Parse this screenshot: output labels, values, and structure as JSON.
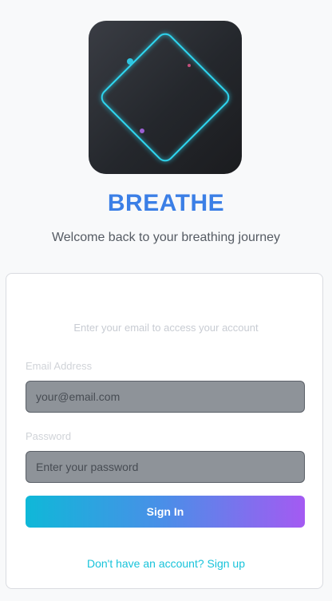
{
  "app": {
    "brand": "BREATHE",
    "tagline": "Welcome back to your breathing journey",
    "accent": "#3b7fe6",
    "logo_icon": "glowing-diamond-icon"
  },
  "login_card": {
    "subtitle": "Enter your email to access your account",
    "email_label": "Email Address",
    "email_value": "",
    "email_placeholder": "your@email.com",
    "password_label": "Password",
    "password_value": "",
    "password_placeholder": "Enter your password",
    "signin_label": "Sign In",
    "signup_link": "Don't have an account? Sign up"
  },
  "colors": {
    "diamond_glow": "#2fd6f0",
    "button_gradient": [
      "#0fb8d8",
      "#4b8ee8",
      "#a45af2"
    ],
    "link": "#18c3da"
  }
}
